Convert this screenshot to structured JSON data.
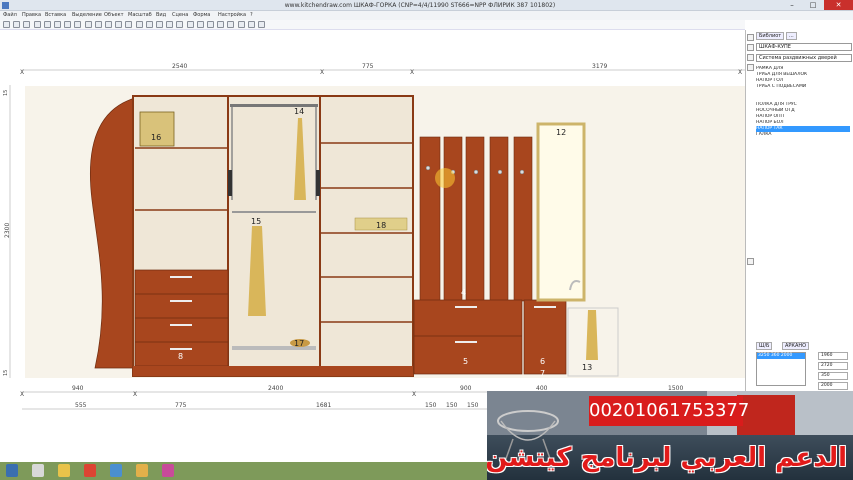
{
  "window": {
    "title": "www.kitchendraw.com   ШКАФ-ГОРКА   (CNP=4/4/11990 ST666=NPP ФЛИРИК 387 101802)",
    "min": "–",
    "max": "□",
    "close": "✕"
  },
  "menu": [
    "Файл",
    "Правка",
    "Вставка",
    "Выделение",
    "Объект",
    "Масштаб",
    "Вид",
    "Сцена",
    "Форма",
    "Настройка",
    "?"
  ],
  "toolbar_icons": [
    "new-icon",
    "open-icon",
    "save-icon",
    "print-icon",
    "cut-icon",
    "copy-icon",
    "paste-icon",
    "undo-icon",
    "redo-icon",
    "info-icon",
    "move-icon",
    "rotate-icon",
    "zoom-in-icon",
    "zoom-out-icon",
    "zoom-window-icon",
    "zoom-all-icon",
    "view-front-icon",
    "view-top-icon",
    "view-3d-icon",
    "render-icon",
    "grid-icon",
    "snap-icon",
    "dimension-icon",
    "text-icon",
    "camera-icon",
    "light-icon"
  ],
  "drawing": {
    "top_dims": [
      "2540",
      "775",
      "3179"
    ],
    "left_dim": "2300",
    "left_small_dims": [
      "15",
      "15"
    ],
    "part_numbers": [
      "16",
      "14",
      "15",
      "18",
      "17",
      "8",
      "12",
      "4",
      "5",
      "6",
      "7",
      "13"
    ],
    "bottom_dims_row1": [
      "940",
      "2400",
      "900",
      "400",
      "1500"
    ],
    "bottom_dims_row2": [
      "555",
      "775",
      "1681",
      "150",
      "150",
      "150",
      "150"
    ],
    "axis_marks": [
      "X",
      "X",
      "X",
      "X",
      "X",
      "X",
      "X"
    ]
  },
  "right_panel": {
    "tabs": [
      "Библиот",
      "..."
    ],
    "catalog": "ШКАФ-КУПЕ",
    "category": "Система раздвижных дверей",
    "items": [
      "РАМКА ДЛЯ",
      "ТРУБА ДЛЯ ВЕШАЛОК",
      "НАПОР ГОЛ",
      "ТРУБА С ПОДВЕСАМИ",
      "",
      "",
      "ПОЛКА ДЛЯ ТРУС",
      "НОСОЧНЫЙ ОТД",
      "НАПОР ОПП",
      "НАПОР БОЛ",
      "НАПОР ТАК",
      "ГАЛКА"
    ],
    "selected_index": 10,
    "lower_tabs": [
      "Ш/Б",
      "АРКАНО"
    ],
    "lower_list": [
      "3250 360 2000"
    ],
    "lower_values": [
      "1960",
      "2720",
      "350",
      "2000"
    ]
  },
  "ad": {
    "phone": "00201061753377",
    "arabic": "الدعم العربي لبرنامج كيتشن درو"
  },
  "taskbar": [
    "start-icon",
    "file-icon",
    "explorer-icon",
    "chrome-icon",
    "kitchendraw-icon",
    "folder-icon",
    "paint-icon"
  ]
}
